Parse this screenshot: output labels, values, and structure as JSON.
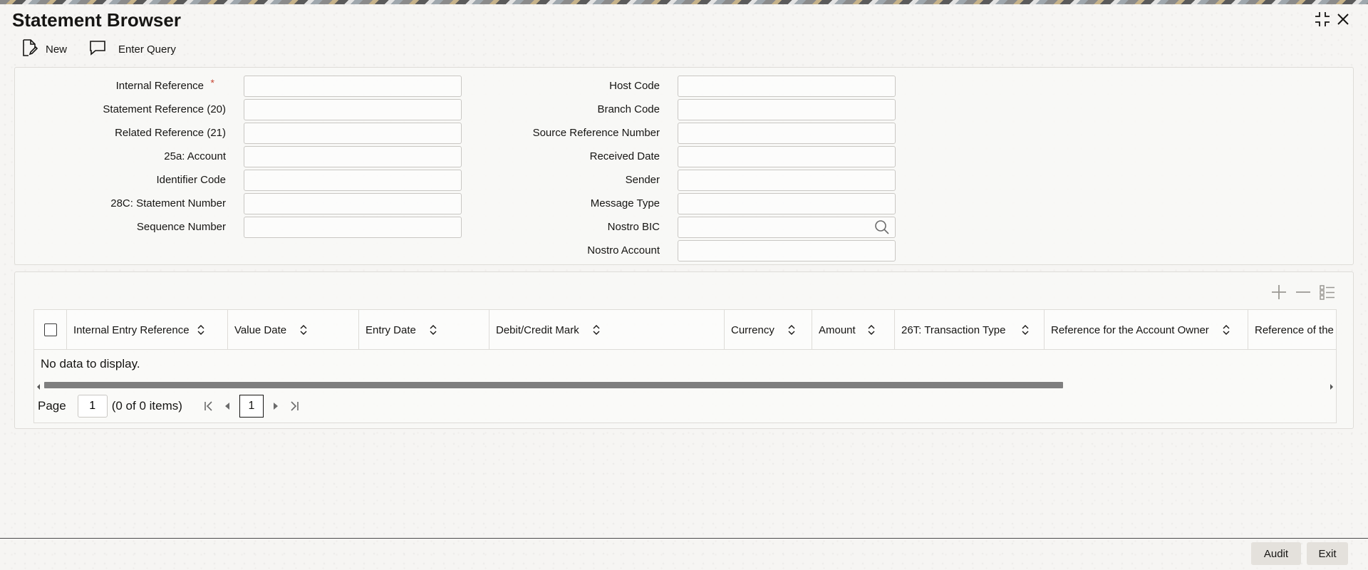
{
  "window": {
    "title": "Statement Browser"
  },
  "toolbar": {
    "new_label": "New",
    "enter_query_label": "Enter Query"
  },
  "form": {
    "left_fields": [
      {
        "label": "Internal Reference",
        "required": true,
        "value": ""
      },
      {
        "label": "Statement Reference (20)",
        "value": ""
      },
      {
        "label": "Related Reference (21)",
        "value": ""
      },
      {
        "label": "25a: Account",
        "value": ""
      },
      {
        "label": "Identifier Code",
        "value": ""
      },
      {
        "label": "28C: Statement Number",
        "value": ""
      },
      {
        "label": "Sequence Number",
        "value": ""
      }
    ],
    "right_fields": [
      {
        "label": "Host Code",
        "value": ""
      },
      {
        "label": "Branch Code",
        "value": ""
      },
      {
        "label": "Source Reference Number",
        "value": ""
      },
      {
        "label": "Received Date",
        "value": ""
      },
      {
        "label": "Sender",
        "value": ""
      },
      {
        "label": "Message Type",
        "value": ""
      },
      {
        "label": "Nostro BIC",
        "value": "",
        "search": true
      },
      {
        "label": "Nostro Account",
        "value": ""
      }
    ],
    "required_mark": "*"
  },
  "grid": {
    "columns": [
      "Internal Entry Reference",
      "Value Date",
      "Entry Date",
      "Debit/Credit Mark",
      "Currency",
      "Amount",
      "26T: Transaction Type",
      "Reference for the Account Owner",
      "Reference of the"
    ],
    "empty_message": "No data to display.",
    "pager": {
      "page_label": "Page",
      "page_value": "1",
      "count_text": "(0 of 0 items)",
      "current_page": "1"
    }
  },
  "footer": {
    "audit_label": "Audit",
    "exit_label": "Exit"
  }
}
